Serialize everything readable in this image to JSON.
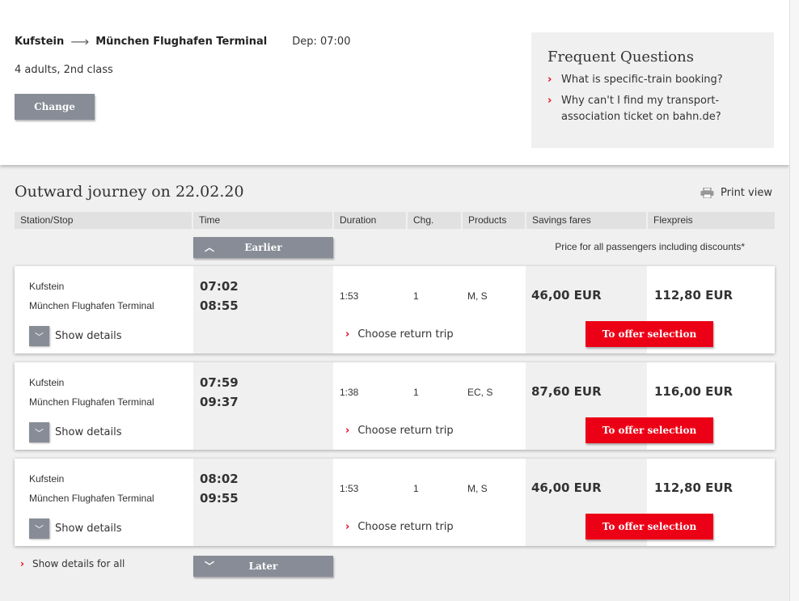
{
  "search": {
    "from": "Kufstein",
    "to": "München Flughafen Terminal",
    "departure": "Dep: 07:00",
    "passengers": "4 adults, 2nd class",
    "change_label": "Change"
  },
  "faq": {
    "title": "Frequent Questions",
    "items": [
      "What is specific-train booking?",
      "Why can't I find my transport-association ticket on bahn.de?"
    ]
  },
  "results": {
    "title": "Outward journey on 22.02.20",
    "print_label": "Print view",
    "columns": [
      "Station/Stop",
      "Time",
      "Duration",
      "Chg.",
      "Products",
      "Savings fares",
      "Flexpreis"
    ],
    "earlier_label": "Earlier",
    "later_label": "Later",
    "price_note": "Price for all passengers including discounts*",
    "show_details_label": "Show details",
    "return_label": "Choose return trip",
    "offer_label": "To offer selection",
    "show_all_label": "Show details for all",
    "connections": [
      {
        "from": "Kufstein",
        "to": "München Flughafen Terminal",
        "dep": "07:02",
        "arr": "08:55",
        "duration": "1:53",
        "changes": "1",
        "products": "M, S",
        "savings": "46,00 EUR",
        "flex": "112,80 EUR"
      },
      {
        "from": "Kufstein",
        "to": "München Flughafen Terminal",
        "dep": "07:59",
        "arr": "09:37",
        "duration": "1:38",
        "changes": "1",
        "products": "EC, S",
        "savings": "87,60 EUR",
        "flex": "116,00 EUR"
      },
      {
        "from": "Kufstein",
        "to": "München Flughafen Terminal",
        "dep": "08:02",
        "arr": "09:55",
        "duration": "1:53",
        "changes": "1",
        "products": "M, S",
        "savings": "46,00 EUR",
        "flex": "112,80 EUR"
      }
    ]
  },
  "colors": {
    "accent": "#ec0016",
    "button_grey": "#878c96"
  }
}
